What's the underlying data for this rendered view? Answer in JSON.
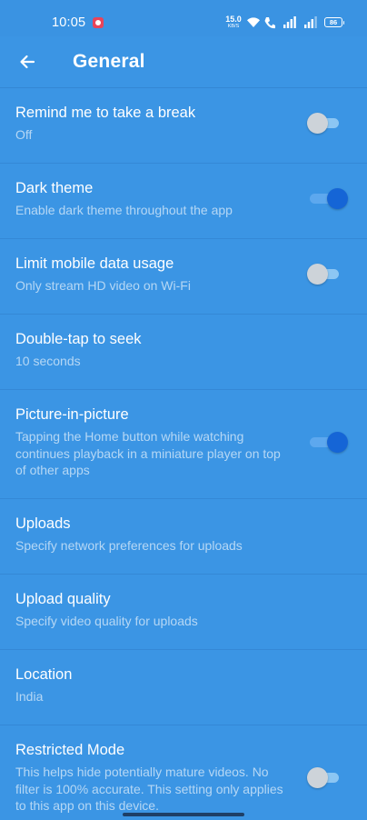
{
  "status_bar": {
    "time": "10:05",
    "net_speed_value": "15.0",
    "net_speed_unit": "KB/S",
    "battery": "86"
  },
  "header": {
    "title": "General"
  },
  "settings": [
    {
      "title": "Remind me to take a break",
      "subtitle": "Off",
      "toggle": "off"
    },
    {
      "title": "Dark theme",
      "subtitle": "Enable dark theme throughout the app",
      "toggle": "on"
    },
    {
      "title": "Limit mobile data usage",
      "subtitle": "Only stream HD video on Wi-Fi",
      "toggle": "off"
    },
    {
      "title": "Double-tap to seek",
      "subtitle": "10 seconds",
      "toggle": "none"
    },
    {
      "title": "Picture-in-picture",
      "subtitle": "Tapping the Home button while watching continues playback in a miniature player on top of other apps",
      "toggle": "on"
    },
    {
      "title": "Uploads",
      "subtitle": "Specify network preferences for uploads",
      "toggle": "none"
    },
    {
      "title": "Upload quality",
      "subtitle": "Specify video quality for uploads",
      "toggle": "none"
    },
    {
      "title": "Location",
      "subtitle": "India",
      "toggle": "none"
    },
    {
      "title": "Restricted Mode",
      "subtitle": "This helps hide potentially mature videos. No filter is 100% accurate. This setting only applies to this app on this device.",
      "toggle": "off"
    }
  ],
  "icons": {
    "back": "arrow-left-icon",
    "recording": "screen-record-icon",
    "wifi": "wifi-icon",
    "volte": "volte-icon",
    "signal": "signal-icon",
    "battery": "battery-icon"
  }
}
